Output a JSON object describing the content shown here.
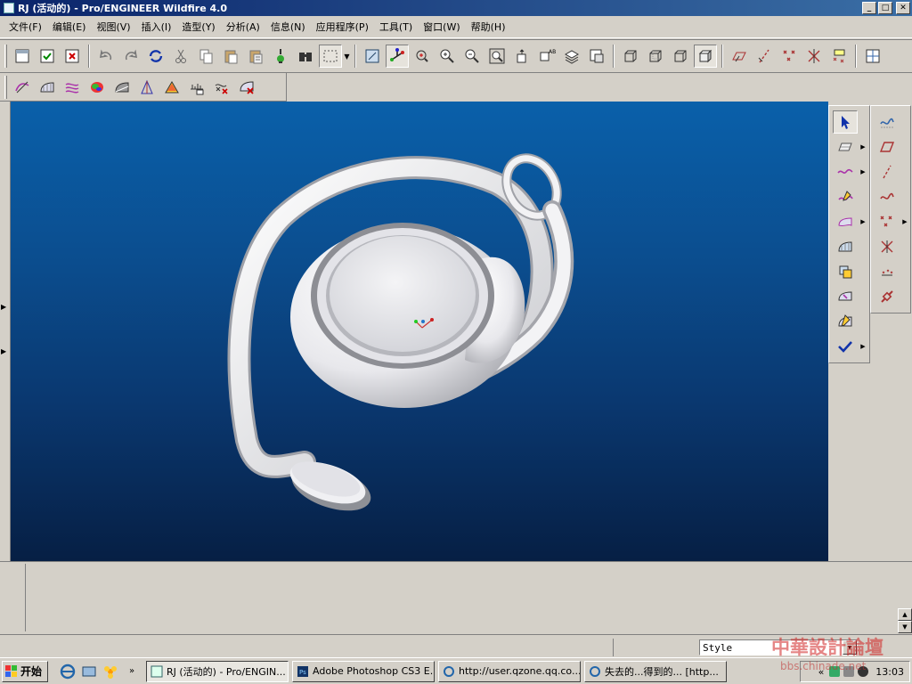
{
  "window": {
    "title": "RJ (活动的) - Pro/ENGINEER Wildfire 4.0",
    "min": "_",
    "max": "□",
    "close": "✕"
  },
  "menu": [
    "文件(F)",
    "编辑(E)",
    "视图(V)",
    "插入(I)",
    "造型(Y)",
    "分析(A)",
    "信息(N)",
    "应用程序(P)",
    "工具(T)",
    "窗口(W)",
    "帮助(H)"
  ],
  "toolbar1": {
    "file_group": [
      "window-icon",
      "save-icon",
      "close-window-icon"
    ],
    "edit_group": [
      "undo-icon",
      "redo-icon",
      "regenerate-icon",
      "cut-icon",
      "copy-icon",
      "paste-icon",
      "paste-special-icon",
      "model-tree-icon",
      "find-icon",
      "select-box-icon"
    ],
    "view_group": [
      "redraw-icon",
      "spin-center-icon",
      "orient-icon",
      "zoom-in-icon",
      "zoom-out-icon",
      "refit-icon",
      "reorient-icon",
      "saved-views-icon",
      "layers-icon",
      "view-manager-icon"
    ],
    "display_group": [
      "wireframe-icon",
      "hidden-line-icon",
      "no-hidden-icon",
      "shading-icon"
    ],
    "datum_group": [
      "datum-planes-icon",
      "datum-axes-icon",
      "datum-points-icon",
      "coordinate-systems-icon",
      "annotations-icon"
    ],
    "extra_group": [
      "grid-icon"
    ]
  },
  "toolbar2": {
    "analysis_group": [
      "curve-analysis-icon",
      "surface-analysis-icon",
      "reflection-icon",
      "shaded-curvature-icon",
      "draft-icon",
      "slope-icon",
      "dihedral-icon",
      "deviation-icon",
      "curvature-delete-icon",
      "surface-delete-icon"
    ]
  },
  "right_toolbar_a": [
    "select-arrow-icon",
    "set-active-plane-icon",
    "curve-icon",
    "curve-on-surface-icon",
    "boundary-surface-icon",
    "loft-surface-icon",
    "curve-from-cos-icon",
    "surface-trim-icon",
    "surface-edit-icon",
    "done-check-icon"
  ],
  "right_toolbar_b": [
    "sketch-curve-icon",
    "datum-plane-icon",
    "datum-axis-icon",
    "sketched-curve-icon",
    "datum-point-icon",
    "offset-point-icon",
    "point-field-icon",
    "coordinate-link-icon"
  ],
  "statusbar": {
    "filter_value": "Style",
    "filter_arrow": "▼"
  },
  "taskbar": {
    "start_label": "开始",
    "tasks": [
      {
        "label": "RJ (活动的) - Pro/ENGIN...",
        "active": true
      },
      {
        "label": "Adobe Photoshop CS3 E...",
        "active": false
      },
      {
        "label": "http://user.qzone.qq.co...",
        "active": false
      },
      {
        "label": "失去的...得到的... [http...",
        "active": false
      }
    ],
    "clock": "13:03",
    "tray_chevron": "«"
  },
  "watermark": {
    "line1": "中華設計論壇",
    "line2": "bbs.chinade.net"
  },
  "colors": {
    "viewport_top": "#0a60aa",
    "viewport_bottom": "#061f44",
    "titlebar": "#0a246a",
    "chrome": "#d4d0c8"
  }
}
